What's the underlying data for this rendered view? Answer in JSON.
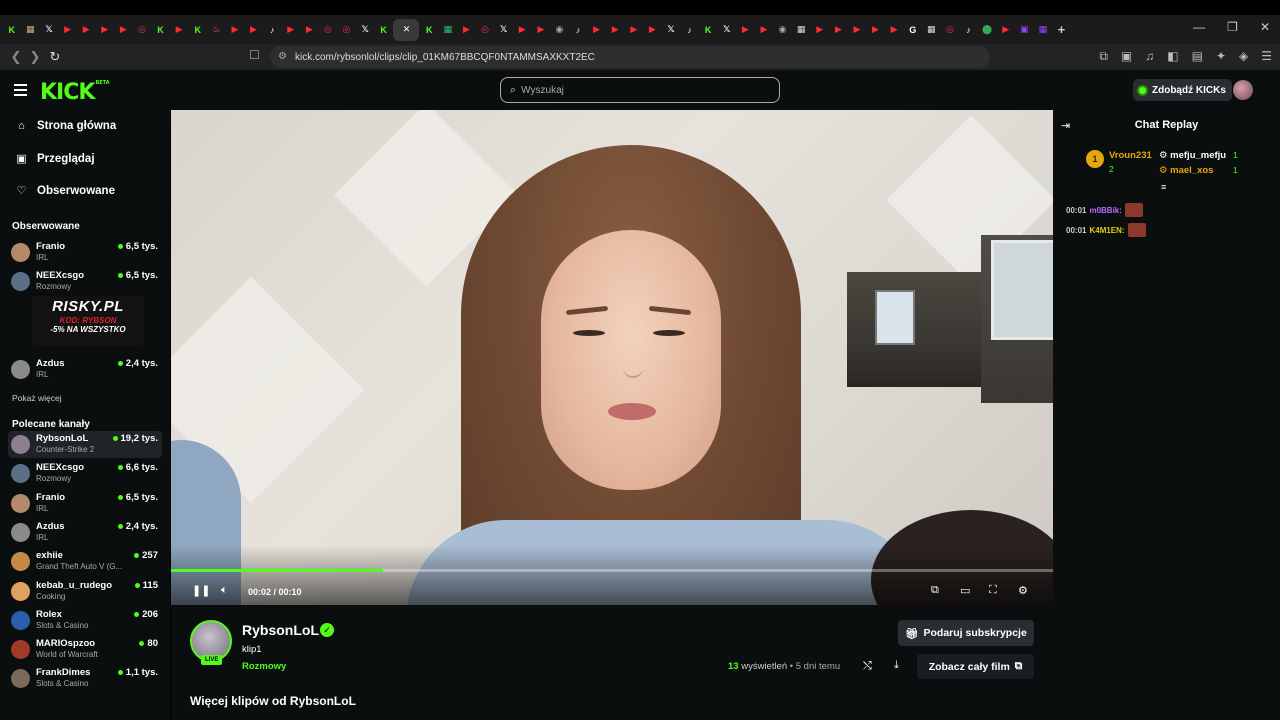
{
  "browser": {
    "tabs": [
      {
        "icon": "kick-icon",
        "color": "#53fc18"
      },
      {
        "icon": "page-icon",
        "color": "#c7b07a"
      },
      {
        "icon": "x-icon",
        "color": "#ffffff"
      },
      {
        "icon": "youtube-icon",
        "color": "#ff2d2d"
      },
      {
        "icon": "youtube-icon",
        "color": "#ff2d2d"
      },
      {
        "icon": "youtube-icon",
        "color": "#ff2d2d"
      },
      {
        "icon": "youtube-icon",
        "color": "#ff2d2d"
      },
      {
        "icon": "instagram-icon",
        "color": "#e1306c"
      },
      {
        "icon": "kick-icon",
        "color": "#53fc18"
      },
      {
        "icon": "youtube-icon",
        "color": "#ff2d2d"
      },
      {
        "icon": "kick-icon",
        "color": "#53fc18"
      },
      {
        "icon": "tinder-icon",
        "color": "#ff5864"
      },
      {
        "icon": "youtube-icon",
        "color": "#ff2d2d"
      },
      {
        "icon": "youtube-icon",
        "color": "#ff2d2d"
      },
      {
        "icon": "tiktok-icon",
        "color": "#ffffff"
      },
      {
        "icon": "youtube-icon",
        "color": "#ff2d2d"
      },
      {
        "icon": "youtube-icon",
        "color": "#ff2d2d"
      },
      {
        "icon": "instagram-icon",
        "color": "#e1306c"
      },
      {
        "icon": "instagram-icon",
        "color": "#e1306c"
      },
      {
        "icon": "x-icon",
        "color": "#ffffff"
      },
      {
        "icon": "kick-icon",
        "color": "#53fc18"
      },
      {
        "icon": "close-icon",
        "color": "#ffffff",
        "active": true
      },
      {
        "icon": "kick-icon",
        "color": "#53fc18"
      },
      {
        "icon": "page-icon",
        "color": "#34c17a"
      },
      {
        "icon": "youtube-icon",
        "color": "#ff2d2d"
      },
      {
        "icon": "instagram-icon",
        "color": "#e1306c"
      },
      {
        "icon": "x-icon",
        "color": "#ffffff"
      },
      {
        "icon": "youtube-icon",
        "color": "#ff2d2d"
      },
      {
        "icon": "youtube-icon",
        "color": "#ff2d2d"
      },
      {
        "icon": "globe-icon",
        "color": "#aaaaaa"
      },
      {
        "icon": "tiktok-icon",
        "color": "#ffffff"
      },
      {
        "icon": "youtube-icon",
        "color": "#ff2d2d"
      },
      {
        "icon": "youtube-icon",
        "color": "#ff2d2d"
      },
      {
        "icon": "youtube-icon",
        "color": "#ff2d2d"
      },
      {
        "icon": "youtube-icon",
        "color": "#ff2d2d"
      },
      {
        "icon": "x-icon",
        "color": "#ffffff"
      },
      {
        "icon": "tiktok-icon",
        "color": "#ffffff"
      },
      {
        "icon": "kick-icon",
        "color": "#53fc18"
      },
      {
        "icon": "x-icon",
        "color": "#ffffff"
      },
      {
        "icon": "youtube-icon",
        "color": "#ff2d2d"
      },
      {
        "icon": "youtube-icon",
        "color": "#ff2d2d"
      },
      {
        "icon": "globe-icon",
        "color": "#aaaaaa"
      },
      {
        "icon": "page-icon",
        "color": "#dddddd"
      },
      {
        "icon": "youtube-icon",
        "color": "#ff2d2d"
      },
      {
        "icon": "youtube-icon",
        "color": "#ff2d2d"
      },
      {
        "icon": "youtube-icon",
        "color": "#ff2d2d"
      },
      {
        "icon": "youtube-icon",
        "color": "#ff2d2d"
      },
      {
        "icon": "youtube-icon",
        "color": "#ff2d2d"
      },
      {
        "icon": "google-icon",
        "color": "#ffffff"
      },
      {
        "icon": "page-icon",
        "color": "#dddddd"
      },
      {
        "icon": "instagram-icon",
        "color": "#e1306c"
      },
      {
        "icon": "tiktok-icon",
        "color": "#ffffff"
      },
      {
        "icon": "maps-icon",
        "color": "#34a853"
      },
      {
        "icon": "youtube-icon",
        "color": "#ff2d2d"
      },
      {
        "icon": "twitch-icon",
        "color": "#9146ff"
      },
      {
        "icon": "page-icon",
        "color": "#9146ff"
      }
    ],
    "new_tab": "+",
    "window_controls": {
      "minimize": "—",
      "maximize": "❐",
      "close": "✕"
    },
    "url": "kick.com/rybsonlol/clips/clip_01KM67BBCQF0NTAMMSAXKXT2EC"
  },
  "header": {
    "logo": "KICK",
    "logo_tag": "BETA",
    "search_placeholder": "Wyszukaj",
    "kicks_button": "Zdobądź KICKs"
  },
  "sidebar": {
    "nav": [
      {
        "label": "Strona główna",
        "icon": "home-icon"
      },
      {
        "label": "Przeglądaj",
        "icon": "browse-icon"
      },
      {
        "label": "Obserwowane",
        "icon": "heart-icon"
      }
    ],
    "followed_title": "Obserwowane",
    "followed": [
      {
        "name": "Franio",
        "category": "IRL",
        "viewers": "6,5 tys.",
        "color": "#b48a6a"
      },
      {
        "name": "NEEXcsgo",
        "category": "Rozmowy",
        "viewers": "6,5 tys.",
        "color": "#5a6e86"
      },
      {
        "name": "Azdus",
        "category": "IRL",
        "viewers": "2,4 tys.",
        "color": "#8a8a8a"
      }
    ],
    "promo": {
      "title": "RISKY.PL",
      "code": "KOD: RYBSON",
      "discount": "-5% NA WSZYSTKO"
    },
    "show_more": "Pokaż więcej",
    "recommended_title": "Polecane kanały",
    "recommended": [
      {
        "name": "RybsonLoL",
        "category": "Counter-Strike 2",
        "viewers": "19,2 tys.",
        "color": "#8c7f92",
        "active": true
      },
      {
        "name": "NEEXcsgo",
        "category": "Rozmowy",
        "viewers": "6,6 tys.",
        "color": "#5a6e86"
      },
      {
        "name": "Franio",
        "category": "IRL",
        "viewers": "6,5 tys.",
        "color": "#b48a6a"
      },
      {
        "name": "Azdus",
        "category": "IRL",
        "viewers": "2,4 tys.",
        "color": "#8a8a8a"
      },
      {
        "name": "exhiie",
        "category": "Grand Theft Auto V (G...",
        "viewers": "257",
        "color": "#c58a4a"
      },
      {
        "name": "kebab_u_rudego",
        "category": "Cooking",
        "viewers": "115",
        "color": "#e0a060"
      },
      {
        "name": "Rolex",
        "category": "Slots & Casino",
        "viewers": "206",
        "color": "#2a5fb0"
      },
      {
        "name": "MARIOspzoo",
        "category": "World of Warcraft",
        "viewers": "80",
        "color": "#a03a2a"
      },
      {
        "name": "FrankDimes",
        "category": "Slots & Casino",
        "viewers": "1,1 tys.",
        "color": "#7a6a5a"
      }
    ]
  },
  "player": {
    "time": "00:02 / 00:10",
    "progress": 0.24,
    "progress_color": "#53fc18"
  },
  "chat": {
    "title": "Chat Replay",
    "leaders": [
      {
        "name": "Vroun231",
        "count": "2",
        "color": "#e5a80c"
      },
      {
        "name": "mefju_mefju",
        "count": "1",
        "color": "#ffffff"
      },
      {
        "name": "mael_xos",
        "count": "1",
        "color": "#e5a80c"
      }
    ],
    "leader_rank": "1",
    "messages": [
      {
        "time": "00:01",
        "user": "m0BBik:",
        "color": "#b76cff"
      },
      {
        "time": "00:01",
        "user": "K4M1EN:",
        "color": "#e5c80c"
      }
    ]
  },
  "info": {
    "channel_name": "RybsonLoL",
    "live": "LIVE",
    "clip_title": "klip1",
    "category": "Rozmowy",
    "subscribe_button": "Podaruj subskrypcje",
    "views_count": "13",
    "views_label": "wyświetleń",
    "ago": "• 5 dni temu",
    "full_video_button": "Zobacz cały film",
    "more_clips": "Więcej klipów od RybsonLoL"
  }
}
